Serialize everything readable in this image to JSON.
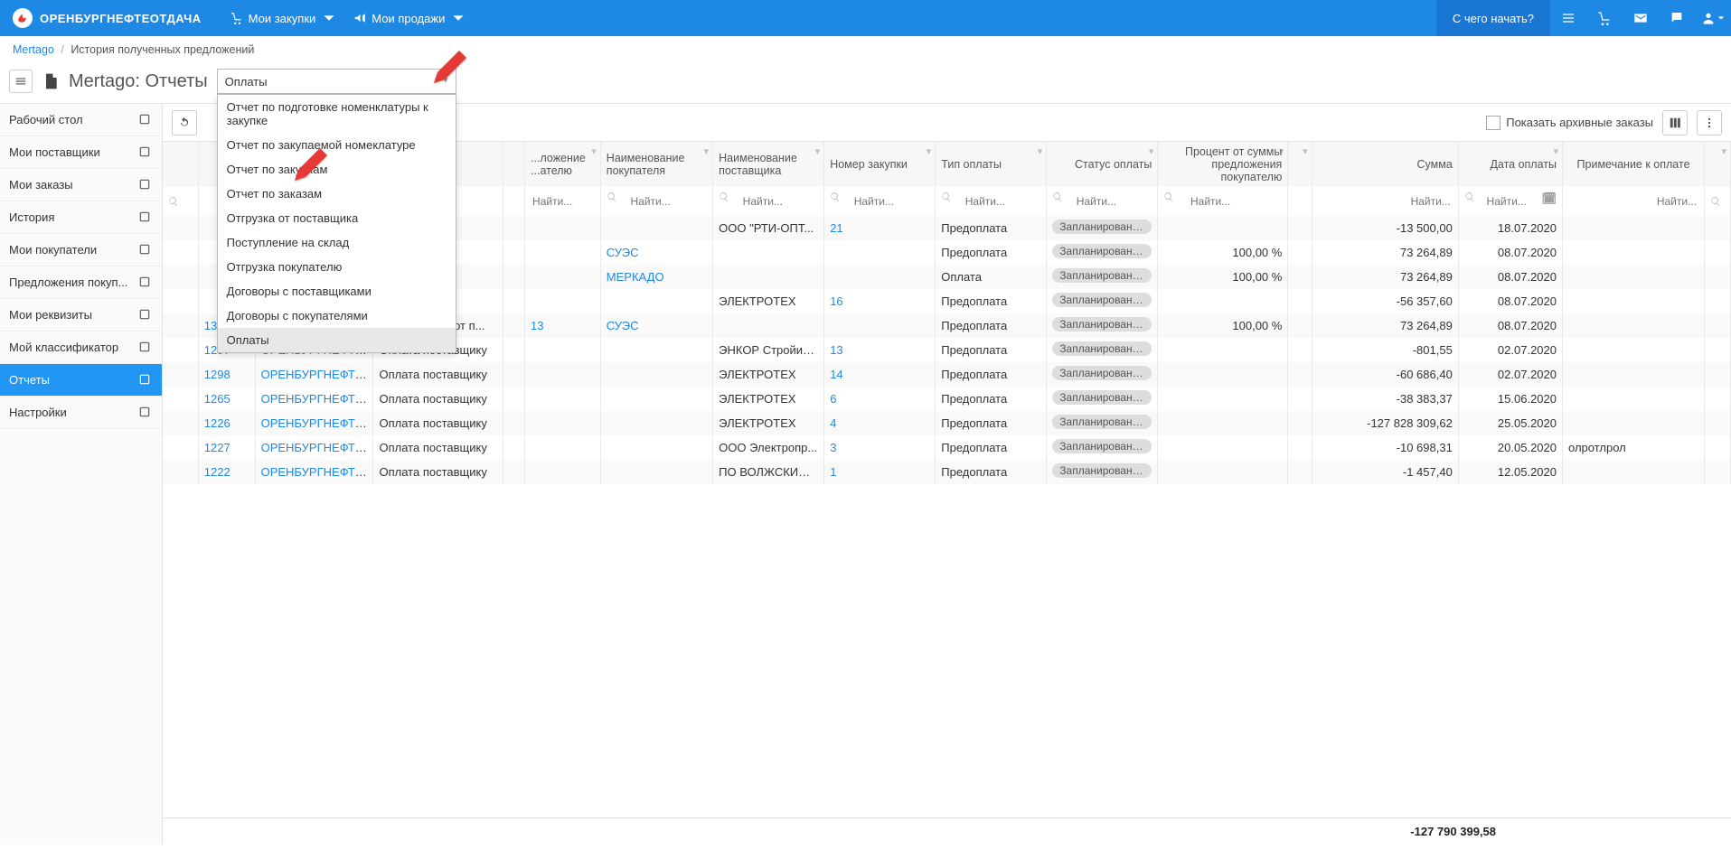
{
  "brand": "ОРЕНБУРГНЕФТЕОТДАЧА",
  "topmenu": {
    "buy": "Мои закупки",
    "sell": "Мои продажи"
  },
  "get_started": "С чего начать?",
  "breadcrumb": {
    "home": "Mertago",
    "current": "История полученных предложений"
  },
  "page_title": "Mertago: Отчеты",
  "report_select_value": "Оплаты",
  "dropdown": [
    "Отчет по подготовке номенклатуры к закупке",
    "Отчет по закупаемой номеклатуре",
    "Отчет по закупкам",
    "Отчет по заказам",
    "Отгрузка от поставщика",
    "Поступление на склад",
    "Отгрузка покупателю",
    "Договоры с поставщиками",
    "Договоры с покупателями",
    "Оплаты"
  ],
  "toolbar": {
    "show_archived": "Показать архивные заказы"
  },
  "sidebar": [
    "Рабочий стол",
    "Мои поставщики",
    "Мои заказы",
    "История",
    "Мои покупатели",
    "Предложения покуп...",
    "Мои реквизиты",
    "Мой классификатор",
    "Отчеты",
    "Настройки"
  ],
  "columns": {
    "offer_to_buyer": "...ложение ...ателю",
    "buyer_name": "Наименование покупателя",
    "supplier_name": "Наименование поставщика",
    "order_no": "Номер закупки",
    "pay_type": "Тип оплаты",
    "status": "Статус оплаты",
    "percent": "Процент от суммы предложения покупателю",
    "sum": "Сумма",
    "date": "Дата оплаты",
    "note": "Примечание к оплате"
  },
  "search_placeholder": "Найти...",
  "rows": [
    {
      "id": "",
      "owner": "",
      "type": "",
      "offer": "",
      "buyer": "",
      "supplier": "ООО \"РТИ-ОПТ...",
      "order": "21",
      "paytype": "Предоплата",
      "status": "Запланировано...",
      "pct": "",
      "sum": "-13 500,00",
      "date": "18.07.2020",
      "note": ""
    },
    {
      "id": "",
      "owner": "",
      "type": "",
      "offer": "",
      "buyer": "СУЭС",
      "supplier": "",
      "order": "",
      "paytype": "Предоплата",
      "status": "Запланировано...",
      "pct": "100,00 %",
      "sum": "73 264,89",
      "date": "08.07.2020",
      "note": ""
    },
    {
      "id": "",
      "owner": "",
      "type": "",
      "offer": "",
      "buyer": "МЕРКАДО",
      "supplier": "",
      "order": "",
      "paytype": "Оплата",
      "status": "Запланировано...",
      "pct": "100,00 %",
      "sum": "73 264,89",
      "date": "08.07.2020",
      "note": ""
    },
    {
      "id": "",
      "owner": "",
      "type": "",
      "offer": "",
      "buyer": "",
      "supplier": "ЭЛЕКТРОТЕХ",
      "order": "16",
      "paytype": "Предоплата",
      "status": "Запланировано...",
      "pct": "",
      "sum": "-56 357,60",
      "date": "08.07.2020",
      "note": ""
    },
    {
      "id": "1303",
      "owner": "ОРЕНБУРГНЕФТЕ...",
      "type": "Поступления от п...",
      "offer": "13",
      "buyer": "СУЭС",
      "supplier": "",
      "order": "",
      "paytype": "Предоплата",
      "status": "Запланировано...",
      "pct": "100,00 %",
      "sum": "73 264,89",
      "date": "08.07.2020",
      "note": ""
    },
    {
      "id": "1297",
      "owner": "ОРЕНБУРГНЕФТЕ...",
      "type": "Оплата поставщику",
      "offer": "",
      "buyer": "",
      "supplier": "ЭНКОР Стройин...",
      "order": "13",
      "paytype": "Предоплата",
      "status": "Запланировано...",
      "pct": "",
      "sum": "-801,55",
      "date": "02.07.2020",
      "note": ""
    },
    {
      "id": "1298",
      "owner": "ОРЕНБУРГНЕФТЕ...",
      "type": "Оплата поставщику",
      "offer": "",
      "buyer": "",
      "supplier": "ЭЛЕКТРОТЕХ",
      "order": "14",
      "paytype": "Предоплата",
      "status": "Запланировано...",
      "pct": "",
      "sum": "-60 686,40",
      "date": "02.07.2020",
      "note": ""
    },
    {
      "id": "1265",
      "owner": "ОРЕНБУРГНЕФТЕ...",
      "type": "Оплата поставщику",
      "offer": "",
      "buyer": "",
      "supplier": "ЭЛЕКТРОТЕХ",
      "order": "6",
      "paytype": "Предоплата",
      "status": "Запланировано...",
      "pct": "",
      "sum": "-38 383,37",
      "date": "15.06.2020",
      "note": ""
    },
    {
      "id": "1226",
      "owner": "ОРЕНБУРГНЕФТЕ...",
      "type": "Оплата поставщику",
      "offer": "",
      "buyer": "",
      "supplier": "ЭЛЕКТРОТЕХ",
      "order": "4",
      "paytype": "Предоплата",
      "status": "Запланировано...",
      "pct": "",
      "sum": "-127 828 309,62",
      "date": "25.05.2020",
      "note": ""
    },
    {
      "id": "1227",
      "owner": "ОРЕНБУРГНЕФТЕ...",
      "type": "Оплата поставщику",
      "offer": "",
      "buyer": "",
      "supplier": "ООО Электропр...",
      "order": "3",
      "paytype": "Предоплата",
      "status": "Запланировано...",
      "pct": "",
      "sum": "-10 698,31",
      "date": "20.05.2020",
      "note": "олротлрол"
    },
    {
      "id": "1222",
      "owner": "ОРЕНБУРГНЕФТЕ...",
      "type": "Оплата поставщику",
      "offer": "",
      "buyer": "",
      "supplier": "ПО ВОЛЖСКИЙ ...",
      "order": "1",
      "paytype": "Предоплата",
      "status": "Запланировано...",
      "pct": "",
      "sum": "-1 457,40",
      "date": "12.05.2020",
      "note": ""
    }
  ],
  "footer_total": "-127 790 399,58"
}
